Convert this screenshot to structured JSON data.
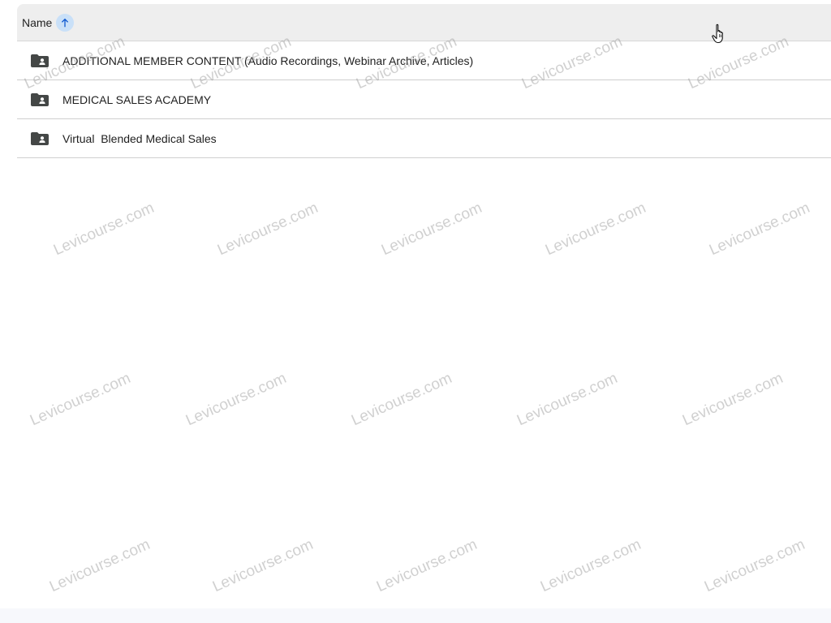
{
  "header": {
    "name_label": "Name",
    "sort_icon": "arrow-upward-icon"
  },
  "rows": [
    {
      "icon": "shared-folder-icon",
      "label": "ADDITIONAL MEMBER CONTENT (Audio Recordings, Webinar Archive, Articles)"
    },
    {
      "icon": "shared-folder-icon",
      "label": "MEDICAL SALES ACADEMY"
    },
    {
      "icon": "shared-folder-icon",
      "label": "Virtual  Blended Medical Sales"
    }
  ],
  "watermark": {
    "text": "Levicourse.com"
  },
  "colors": {
    "header_bg": "#eeeeee",
    "sort_accent": "#0b57d0",
    "sort_bg": "#c9e0f8",
    "folder_icon": "#444746"
  }
}
